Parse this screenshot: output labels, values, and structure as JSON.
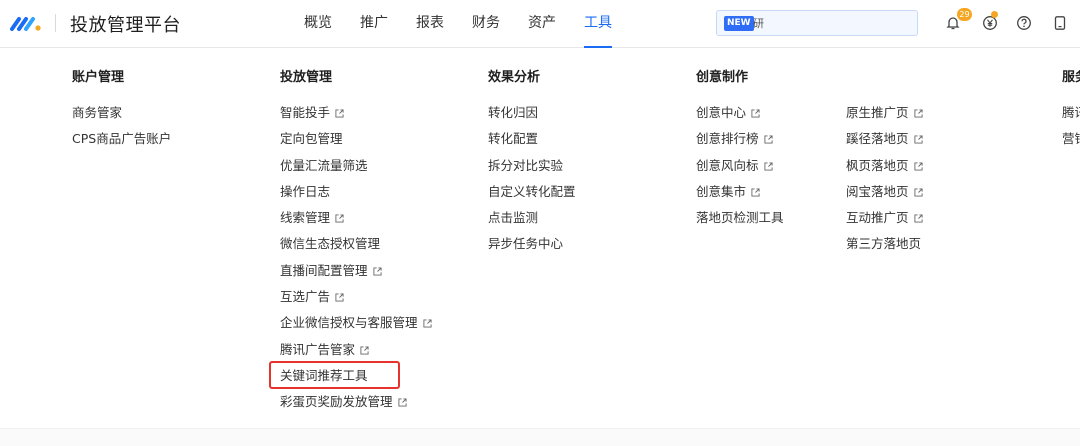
{
  "header": {
    "brand": "投放管理平台",
    "nav": [
      "概览",
      "推广",
      "报表",
      "财务",
      "资产",
      "工具"
    ],
    "active_nav": "工具",
    "search": {
      "badge": "NEW",
      "text": "研"
    },
    "notification_count": "29",
    "icons": [
      "bell-icon",
      "yuan-icon",
      "help-icon",
      "device-icon"
    ],
    "accent_color": "#1a6cf3"
  },
  "menu": {
    "account": {
      "title": "账户管理",
      "items": [
        "商务管家",
        "CPS商品广告账户"
      ]
    },
    "delivery": {
      "title": "投放管理",
      "items": [
        "智能投手",
        "定向包管理",
        "优量汇流量筛选",
        "操作日志",
        "线索管理",
        "微信生态授权管理",
        "直播间配置管理",
        "互选广告",
        "企业微信授权与客服管理",
        "腾讯广告管家",
        "关键词推荐工具",
        "彩蛋页奖励发放管理"
      ]
    },
    "analysis": {
      "title": "效果分析",
      "items": [
        "转化归因",
        "转化配置",
        "拆分对比实验",
        "自定义转化配置",
        "点击监测",
        "异步任务中心"
      ]
    },
    "creative": {
      "title": "创意制作",
      "items_left": [
        "创意中心",
        "创意排行榜",
        "创意风向标",
        "创意集市",
        "落地页检测工具"
      ],
      "items_right": [
        "原生推广页",
        "蹊径落地页",
        "枫页落地页",
        "阅宝落地页",
        "互动推广页",
        "第三方落地页"
      ]
    },
    "service": {
      "title": "服务",
      "items": [
        "腾讯",
        "营销"
      ]
    }
  },
  "highlighted_item": "关键词推荐工具",
  "highlight_color": "#e8322c"
}
